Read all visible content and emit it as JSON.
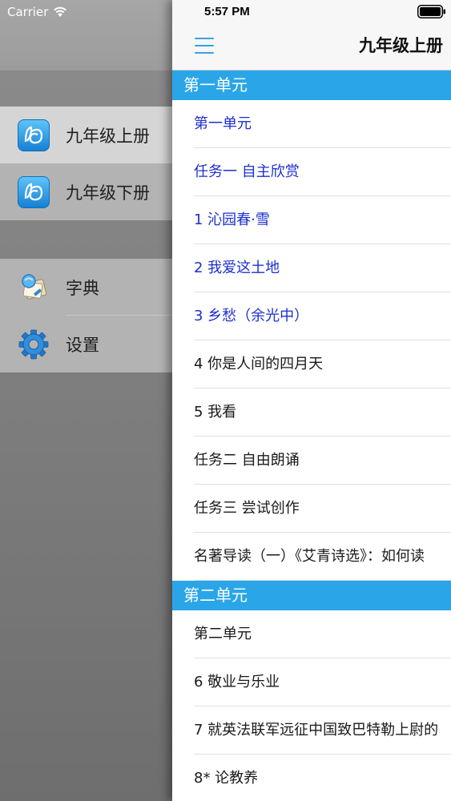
{
  "status_bar": {
    "carrier": "Carrier",
    "time": "5:57 PM"
  },
  "side_menu": {
    "books": [
      {
        "label": "九年级上册",
        "icon": "book-icon",
        "selected": true
      },
      {
        "label": "九年级下册",
        "icon": "book-icon",
        "selected": false
      }
    ],
    "tools": [
      {
        "label": "字典",
        "icon": "dictionary-icon"
      },
      {
        "label": "设置",
        "icon": "gear-icon"
      }
    ]
  },
  "nav": {
    "title": "九年级上册"
  },
  "colors": {
    "section_header": "#2aa6e8",
    "read_item": "#1c2fd0",
    "accent": "#3aa0e6"
  },
  "sections": [
    {
      "header": "第一单元",
      "items": [
        {
          "label": "第一单元",
          "read": true
        },
        {
          "label": "任务一 自主欣赏",
          "read": true
        },
        {
          "label": "1 沁园春·雪",
          "read": true
        },
        {
          "label": "2 我爱这土地",
          "read": true
        },
        {
          "label": "3 乡愁（余光中）",
          "read": true
        },
        {
          "label": "4 你是人间的四月天",
          "read": false
        },
        {
          "label": "5 我看",
          "read": false
        },
        {
          "label": "任务二 自由朗诵",
          "read": false
        },
        {
          "label": "任务三 尝试创作",
          "read": false
        },
        {
          "label": "名著导读（一）《艾青诗选》：如何读",
          "read": false
        }
      ]
    },
    {
      "header": "第二单元",
      "items": [
        {
          "label": "第二单元",
          "read": false
        },
        {
          "label": "6 敬业与乐业",
          "read": false
        },
        {
          "label": "7 就英法联军远征中国致巴特勒上尉的",
          "read": false
        },
        {
          "label": "8* 论教养",
          "read": false
        }
      ]
    }
  ]
}
